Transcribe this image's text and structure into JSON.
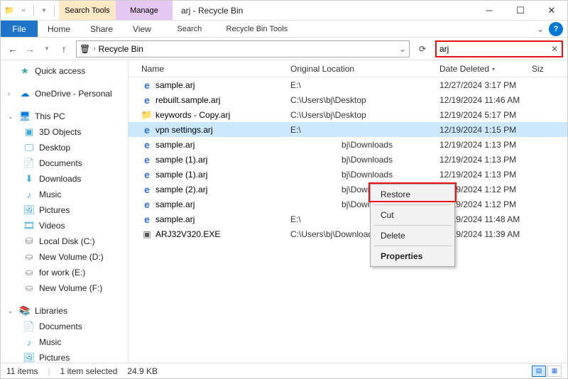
{
  "window": {
    "title": "arj - Recycle Bin"
  },
  "toolbarTabs": {
    "search": "Search Tools",
    "manage": "Manage"
  },
  "ribbon": {
    "file": "File",
    "home": "Home",
    "share": "Share",
    "view": "View",
    "searchSub": "Search",
    "recycleSub": "Recycle Bin Tools"
  },
  "nav": {
    "breadcrumb": "Recycle Bin",
    "search_value": "arj"
  },
  "sidebar": {
    "quick": "Quick access",
    "onedrive": "OneDrive - Personal",
    "thispc": "This PC",
    "threeD": "3D Objects",
    "desktop": "Desktop",
    "documents": "Documents",
    "downloads": "Downloads",
    "music": "Music",
    "pictures": "Pictures",
    "videos": "Videos",
    "localC": "Local Disk (C:)",
    "newVolD": "New Volume (D:)",
    "forWorkE": "for work (E:)",
    "newVolF": "New Volume (F:)",
    "libraries": "Libraries",
    "lib_docs": "Documents",
    "lib_music": "Music",
    "lib_pics": "Pictures"
  },
  "columns": {
    "name": "Name",
    "orig": "Original Location",
    "date": "Date Deleted",
    "size": "Siz"
  },
  "files": [
    {
      "name": "sample.arj",
      "orig": "E:\\",
      "date": "12/27/2024 3:17 PM",
      "icon": "ie"
    },
    {
      "name": "rebuilt.sample.arj",
      "orig": "C:\\Users\\bj\\Desktop",
      "date": "12/19/2024 11:46 AM",
      "icon": "ie"
    },
    {
      "name": "keywords - Copy.arj",
      "orig": "C:\\Users\\bj\\Desktop",
      "date": "12/19/2024 5:17 PM",
      "icon": "folder"
    },
    {
      "name": "vpn settings.arj",
      "orig": "E:\\",
      "date": "12/19/2024 1:15 PM",
      "icon": "ie",
      "selected": true
    },
    {
      "name": "sample.arj",
      "orig": "",
      "date": "12/19/2024 1:13 PM",
      "icon": "ie",
      "origSuffix": "bj\\Downloads"
    },
    {
      "name": "sample (1).arj",
      "orig": "",
      "date": "12/19/2024 1:13 PM",
      "icon": "ie",
      "origSuffix": "bj\\Downloads"
    },
    {
      "name": "sample (1).arj",
      "orig": "",
      "date": "12/19/2024 1:13 PM",
      "icon": "ie",
      "origSuffix": "bj\\Downloads"
    },
    {
      "name": "sample (2).arj",
      "orig": "",
      "date": "12/19/2024 1:12 PM",
      "icon": "ie",
      "origSuffix": "bj\\Downloads"
    },
    {
      "name": "sample.arj",
      "orig": "",
      "date": "12/19/2024 1:12 PM",
      "icon": "ie",
      "origSuffix": "bj\\Downloads"
    },
    {
      "name": "sample.arj",
      "orig": "E:\\",
      "date": "12/19/2024 11:48 AM",
      "icon": "ie"
    },
    {
      "name": "ARJ32V320.EXE",
      "orig": "C:\\Users\\bj\\Downloads",
      "date": "12/19/2024 11:39 AM",
      "icon": "exe"
    }
  ],
  "context": {
    "restore": "Restore",
    "cut": "Cut",
    "delete": "Delete",
    "properties": "Properties"
  },
  "status": {
    "count": "11 items",
    "selection": "1 item selected",
    "size": "24.9 KB"
  }
}
